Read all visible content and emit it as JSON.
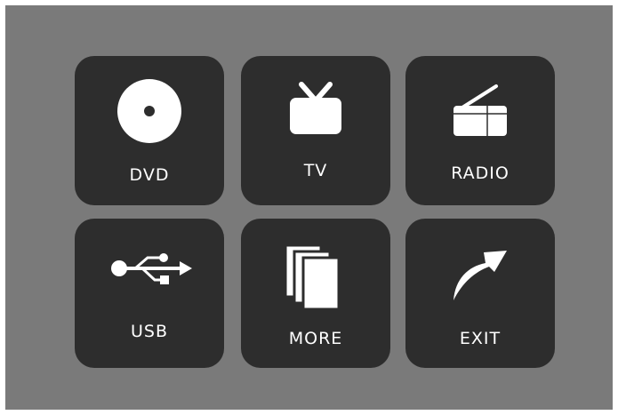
{
  "menu": {
    "items": [
      {
        "id": "dvd",
        "label": "DVD",
        "icon": "disc-icon"
      },
      {
        "id": "tv",
        "label": "TV",
        "icon": "tv-icon"
      },
      {
        "id": "radio",
        "label": "RADIO",
        "icon": "radio-icon"
      },
      {
        "id": "usb",
        "label": "USB",
        "icon": "usb-icon"
      },
      {
        "id": "more",
        "label": "MORE",
        "icon": "pages-icon"
      },
      {
        "id": "exit",
        "label": "EXIT",
        "icon": "curved-arrow-icon"
      }
    ]
  },
  "colors": {
    "background": "#7a7a7a",
    "tile": "#2d2d2d",
    "foreground": "#ffffff"
  }
}
